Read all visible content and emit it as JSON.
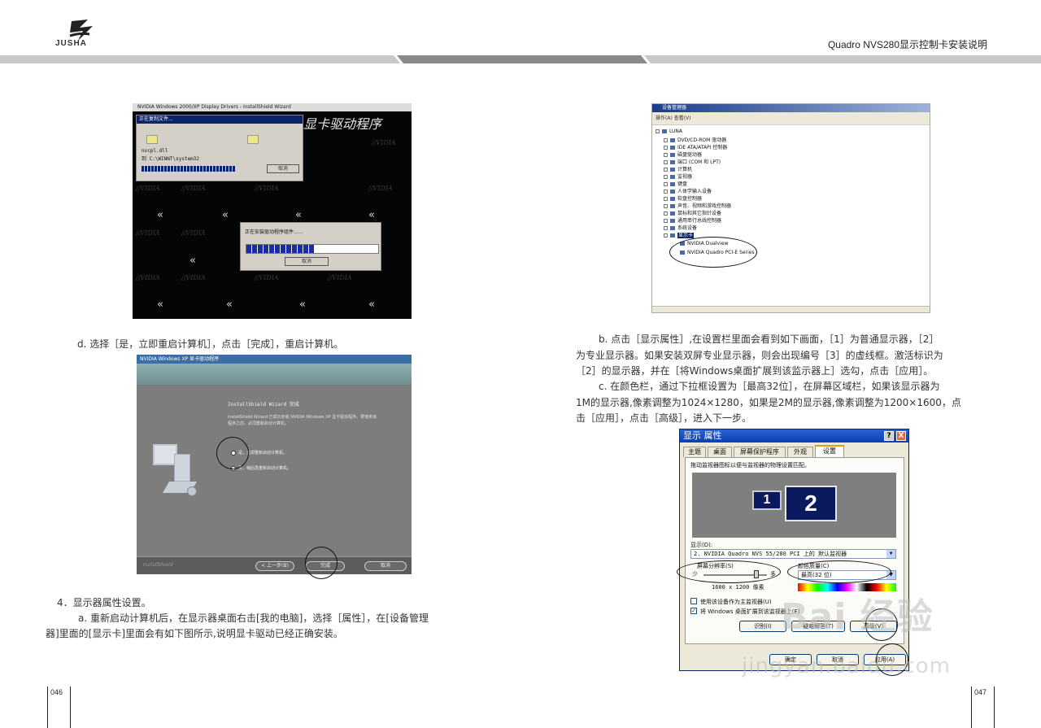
{
  "header": {
    "logo_text": "JUSHA",
    "doc_title": "Quadro NVS280显示控制卡安装说明"
  },
  "left": {
    "fig_install": {
      "window_title": "NVIDIA Windows 2000/XP Display Drivers - InstallShield Wizard",
      "big_title": "显卡驱动程序",
      "ghost_text": "//VIDIA",
      "copy_dialog": {
        "title": "正在复制文件...",
        "file": "nvcpl.dll",
        "dest": "到 C:\\WINNT\\system32",
        "cancel": "取消"
      },
      "progress_dialog": {
        "title": "正在安装驱动程序组件……",
        "cancel": "取消"
      }
    },
    "step_d": "d. 选择［是，立即重启计算机］，点击［完成］，重启计算机。",
    "fig_finish": {
      "window_title": "NVIDIA Windows XP 显卡驱动程序",
      "heading": "InstallShield Wizard 完成",
      "body_line1": "InstallShield Wizard 已成功安装 NVIDIA Windows XP 显卡驱动程序。要使用该",
      "body_line2": "程序之前，必须重新启动计算机。",
      "radio_yes": "是，立即重新启动计算机。",
      "radio_no": "否，稍后再重新启动计算机。",
      "footer_brand": "InstallShield",
      "back_button": "< 上一步(B)",
      "finish_button": "完成",
      "cancel_button": "取消"
    },
    "section_4": "4．显示器属性设置。",
    "para_a_line1": "a. 重新启动计算机后，在显示器桌面右击[我的电脑]，选择［属性］，在[设备管理",
    "para_a_line2": "器]里面的[显示卡]里面会有如下图所示,说明显卡驱动已经正确安装。"
  },
  "right": {
    "fig_devmgr": {
      "window_title": "设备管理器",
      "menu": "操作(A)  查看(V)",
      "root": "LUNA",
      "items": [
        "DVD/CD-ROM 驱动器",
        "IDE ATA/ATAPI 控制器",
        "磁盘驱动器",
        "端口 (COM 和 LPT)",
        "计算机",
        "监视器",
        "键盘",
        "人体学输入设备",
        "软盘控制器",
        "声音、视频和游戏控制器",
        "鼠标和其它指针设备",
        "通用串行总线控制器",
        "系统设备",
        "显示卡"
      ],
      "display_adapters": [
        "NVIDIA Dualview",
        "NVIDIA Quadro PCI-E Series"
      ]
    },
    "para_b_line1": "b. 点击［显示属性］,在设置栏里面会看到如下画面，［1］为普通显示器，［2］",
    "para_b_line2": "为专业显示器。如果安装双屏专业显示器，则会出现编号［3］的虚线框。激活标识为",
    "para_b_line3": "［2］的显示器，并在［将Windows桌面扩展到该监示器上］选勾，点击［应用］。",
    "para_c_line1": "c. 在颜色栏，通过下拉框设置为［最高32位］，在屏幕区域栏，如果该显示器为",
    "para_c_line2": "1M的显示器,像素调整为1024×1280，如果是2M的显示器,像素调整为1200×1600，点",
    "para_c_line3": "击［应用］，点击［高级］，进入下一步。",
    "fig_props": {
      "window_title": "显示 属性",
      "help_btn": "?",
      "close_btn": "X",
      "tabs": [
        "主题",
        "桌面",
        "屏幕保护程序",
        "外观",
        "设置"
      ],
      "instruction": "拖动监视器图标以便与监视器的物理设置匹配。",
      "monitor_1": "1",
      "monitor_2": "2",
      "display_label": "显示(D):",
      "display_value": "2. NVIDIA Quadro NVS 55/280 PCI 上的 默认监视器",
      "resolution_label": "屏幕分辨率(S)",
      "slider_less": "少",
      "slider_more": "多",
      "resolution_value": "1600 x 1200 像素",
      "color_label": "颜色质量(C)",
      "color_value": "最高(32 位)",
      "chk_primary": "使用该设备作为主监视器(U)",
      "chk_extend": "将 Windows 桌面扩展到该监视器上(E)",
      "identify_btn": "识别(I)",
      "troubleshoot_btn": "疑难解答(T)",
      "advanced_btn": "高级(V)",
      "ok_btn": "确定",
      "cancel_btn": "取消",
      "apply_btn": "应用(A)"
    }
  },
  "footer": {
    "page_left": "046",
    "page_right": "047"
  },
  "watermark": {
    "line1": "Bai 经验",
    "line2": "jingyan.baidu.com"
  },
  "colors": {
    "band_light": "#c8c8c8",
    "band_dark": "#8a8a8a",
    "xp_blue": "#0a3fb0",
    "monitor_navy": "#0a1a5c"
  }
}
